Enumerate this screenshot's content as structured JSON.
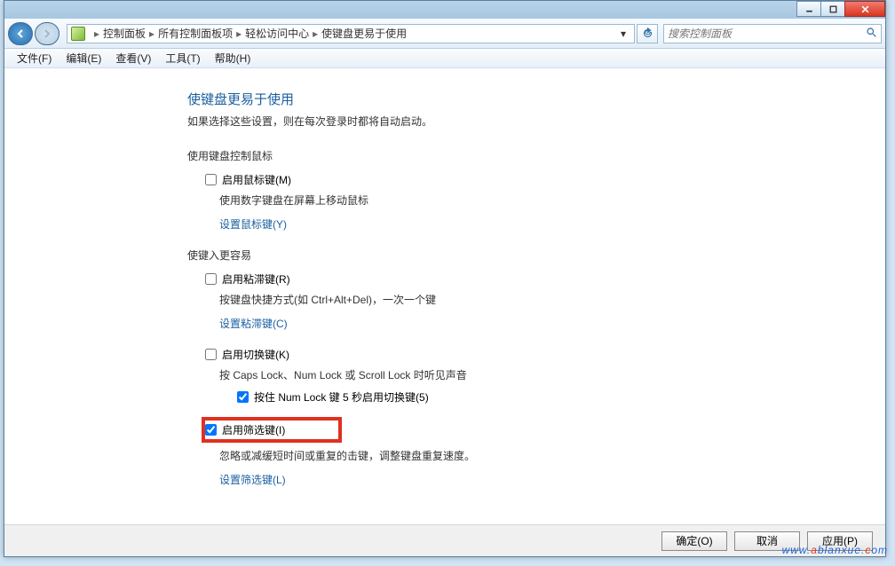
{
  "breadcrumb": [
    "控制面板",
    "所有控制面板项",
    "轻松访问中心",
    "使键盘更易于使用"
  ],
  "search_placeholder": "搜索控制面板",
  "menu": {
    "file": "文件(F)",
    "edit": "编辑(E)",
    "view": "查看(V)",
    "tools": "工具(T)",
    "help": "帮助(H)"
  },
  "page": {
    "title": "使键盘更易于使用",
    "subtitle": "如果选择这些设置，则在每次登录时都将自动启动。",
    "sec1_hdr": "使用键盘控制鼠标",
    "mouse_keys_label": "启用鼠标键(M)",
    "mouse_keys_desc": "使用数字键盘在屏幕上移动鼠标",
    "mouse_keys_link": "设置鼠标键(Y)",
    "sec2_hdr": "使键入更容易",
    "sticky_label": "启用粘滞键(R)",
    "sticky_desc": "按键盘快捷方式(如 Ctrl+Alt+Del)，一次一个键",
    "sticky_link": "设置粘滞键(C)",
    "toggle_label": "启用切换键(K)",
    "toggle_desc": "按 Caps Lock、Num Lock 或 Scroll Lock 时听见声音",
    "toggle_hold_label": "按住 Num Lock 键 5 秒启用切换键(5)",
    "filter_label": "启用筛选键(I)",
    "filter_desc": "忽略或减缓短时间或重复的击键，调整键盘重复速度。",
    "filter_link": "设置筛选键(L)"
  },
  "buttons": {
    "ok": "确定(O)",
    "cancel": "取消",
    "apply": "应用(P)"
  },
  "watermark": {
    "p1": "www.",
    "p2": "a",
    "p3": "blanxue.",
    "p4": "c",
    "p5": "om"
  },
  "checks": {
    "mouse": false,
    "sticky": false,
    "toggle": false,
    "hold": true,
    "filter": true
  }
}
